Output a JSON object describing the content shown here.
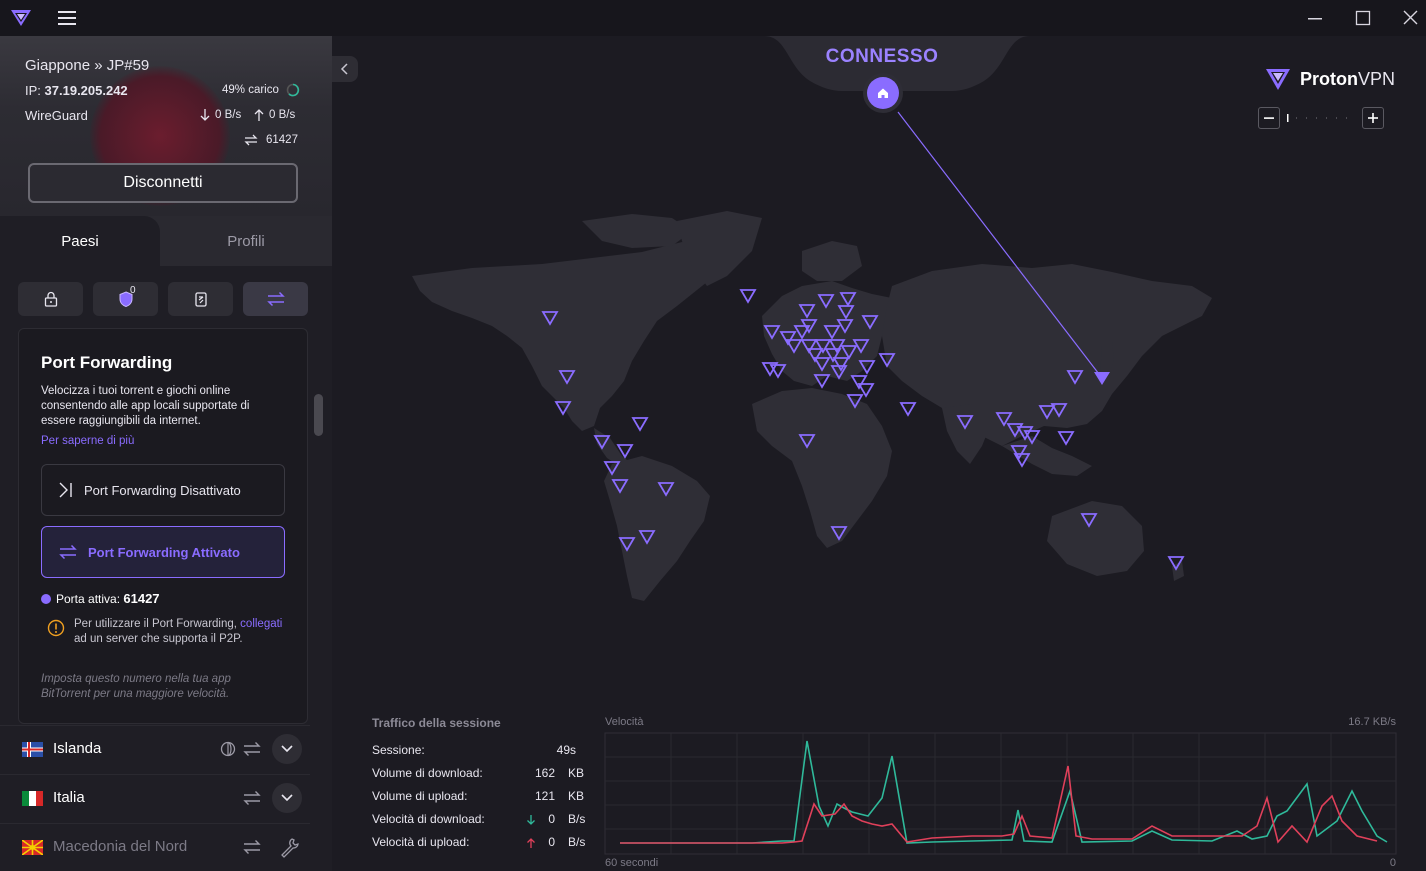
{
  "titlebar": {
    "controls": [
      "minimize",
      "maximize",
      "close"
    ]
  },
  "connection": {
    "server": "Giappone » JP#59",
    "ip_label": "IP:",
    "ip": "37.19.205.242",
    "load": "49% carico",
    "protocol": "WireGuard",
    "download_speed": "0 B/s",
    "upload_speed": "0 B/s",
    "port": "61427",
    "disconnect_label": "Disconnetti"
  },
  "tabs": {
    "countries": "Paesi",
    "profiles": "Profili"
  },
  "filters": {
    "secure_core_count": "0"
  },
  "port_forwarding": {
    "title": "Port Forwarding",
    "description": "Velocizza i tuoi torrent e giochi online consentendo alle app locali supportate di essere raggiungibili da internet.",
    "learn_more": "Per saperne di più",
    "option_off": "Port Forwarding Disattivato",
    "option_on": "Port Forwarding Attivato",
    "active_port_label": "Porta attiva:",
    "active_port": "61427",
    "warning_pre": "Per utilizzare il Port Forwarding, ",
    "warning_link": "collegati",
    "warning_post": " ad un server che supporta il P2P.",
    "hint": "Imposta questo numero nella tua app BitTorrent per una maggiore velocità."
  },
  "countries": [
    {
      "name": "Islanda"
    },
    {
      "name": "Italia"
    },
    {
      "name": "Macedonia del Nord"
    }
  ],
  "map": {
    "status": "CONNESSO",
    "brand_bold": "Proton",
    "brand_light": "VPN"
  },
  "session": {
    "title": "Traffico della sessione",
    "rows": [
      {
        "label": "Sessione:",
        "value": "49s",
        "unit": ""
      },
      {
        "label": "Volume di download:",
        "value": "162",
        "unit": "KB"
      },
      {
        "label": "Volume di upload:",
        "value": "121",
        "unit": "KB"
      },
      {
        "label": "Velocità di download:",
        "value": "0",
        "unit": "B/s"
      },
      {
        "label": "Velocità di upload:",
        "value": "0",
        "unit": "B/s"
      }
    ]
  },
  "speed_graph": {
    "title": "Velocità",
    "max_label": "16.7  KB/s",
    "left_label": "60 secondi",
    "right_label": "0",
    "colors": {
      "download": "#2fb99a",
      "upload": "#e0405a"
    }
  }
}
